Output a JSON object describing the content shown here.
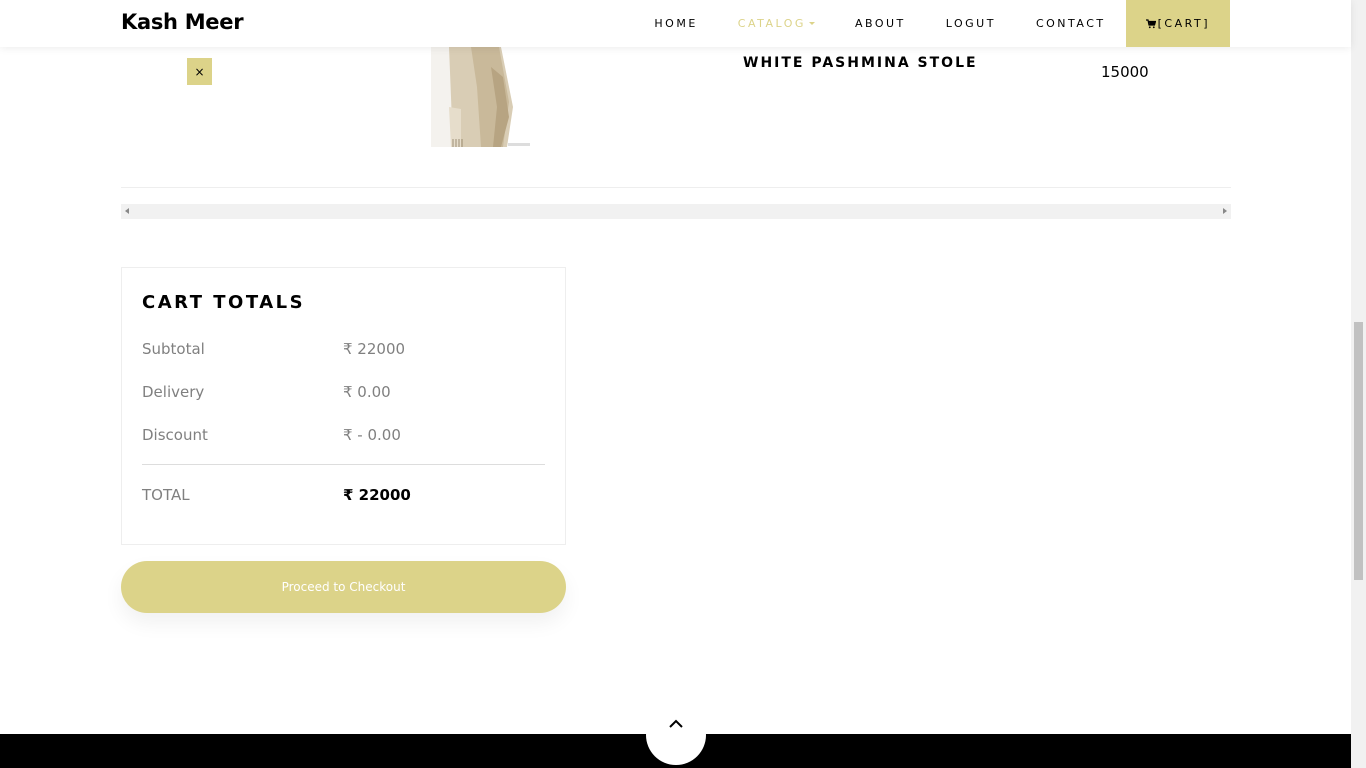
{
  "navbar": {
    "brand": "Kash Meer",
    "items": [
      {
        "label": "Home"
      },
      {
        "label": "Catalog"
      },
      {
        "label": "About"
      },
      {
        "label": "Logut"
      },
      {
        "label": "Contact"
      }
    ],
    "cart_label": "[Cart]"
  },
  "cart": {
    "item": {
      "remove_symbol": "×",
      "name": "White Pashmina Stole",
      "price": "15000"
    }
  },
  "totals": {
    "heading": "Cart Totals",
    "rows": [
      {
        "label": "Subtotal",
        "value": "₹ 22000"
      },
      {
        "label": "Delivery",
        "value": "₹ 0.00"
      },
      {
        "label": "Discount",
        "value": "₹ - 0.00"
      }
    ],
    "total": {
      "label": "TOTAL",
      "value": "₹ 22000"
    },
    "checkout_label": "Proceed to Checkout"
  },
  "colors": {
    "accent": "#dcd389",
    "footer": "#000000"
  },
  "icons": {
    "cart": "cart-icon",
    "back_to_top": "chevron-up-icon"
  }
}
